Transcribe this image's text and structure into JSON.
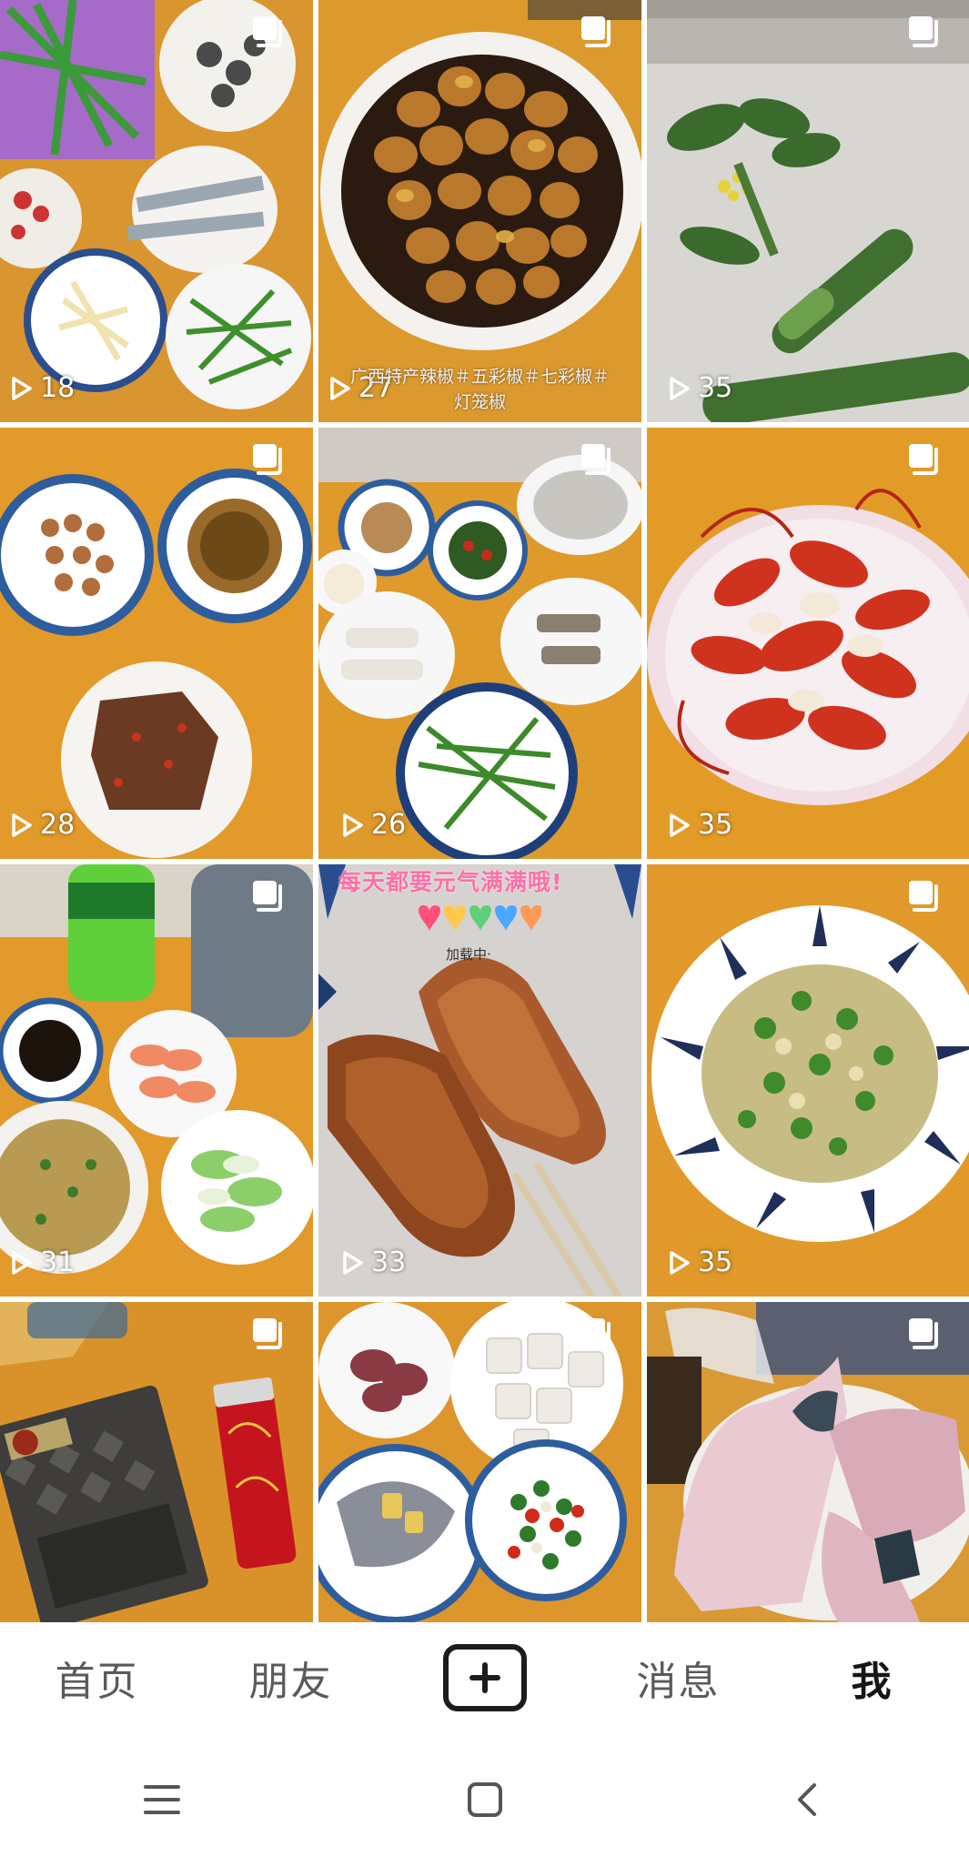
{
  "grid": {
    "tiles": [
      {
        "name": "vegetable-prep",
        "views": "18",
        "multi": true
      },
      {
        "name": "pickled-peppers",
        "views": "27",
        "multi": true,
        "caption": "广西特产辣椒＃五彩椒＃七彩椒＃灯笼椒"
      },
      {
        "name": "greens-on-table",
        "views": "35",
        "multi": true
      },
      {
        "name": "fish-and-peanuts",
        "views": "28",
        "multi": true
      },
      {
        "name": "ingredients-spread",
        "views": "26",
        "multi": true
      },
      {
        "name": "crayfish-plate",
        "views": "35",
        "multi": true
      },
      {
        "name": "shrimp-and-cabbage",
        "views": "31",
        "multi": true
      },
      {
        "name": "chicken-wings",
        "views": "33",
        "multi": false,
        "overlay_text": "每天都要元气满满哦!",
        "overlay_status": "加载中·"
      },
      {
        "name": "egg-and-greens",
        "views": "35",
        "multi": true
      },
      {
        "name": "cigarettes-lighter",
        "views": "",
        "multi": true
      },
      {
        "name": "meat-and-peppers",
        "views": "",
        "multi": true
      },
      {
        "name": "raw-fish",
        "views": "",
        "multi": true
      }
    ]
  },
  "tabbar": {
    "home": "首页",
    "friends": "朋友",
    "add_icon": "plus-icon",
    "messages": "消息",
    "me": "我"
  },
  "navbar": {
    "menu_icon": "menu-icon",
    "home_icon": "home-square-icon",
    "back_icon": "back-icon"
  },
  "colors": {
    "table_orange": "#e09a2a",
    "tab_text": "#5a5a5a",
    "tab_active": "#161616"
  }
}
